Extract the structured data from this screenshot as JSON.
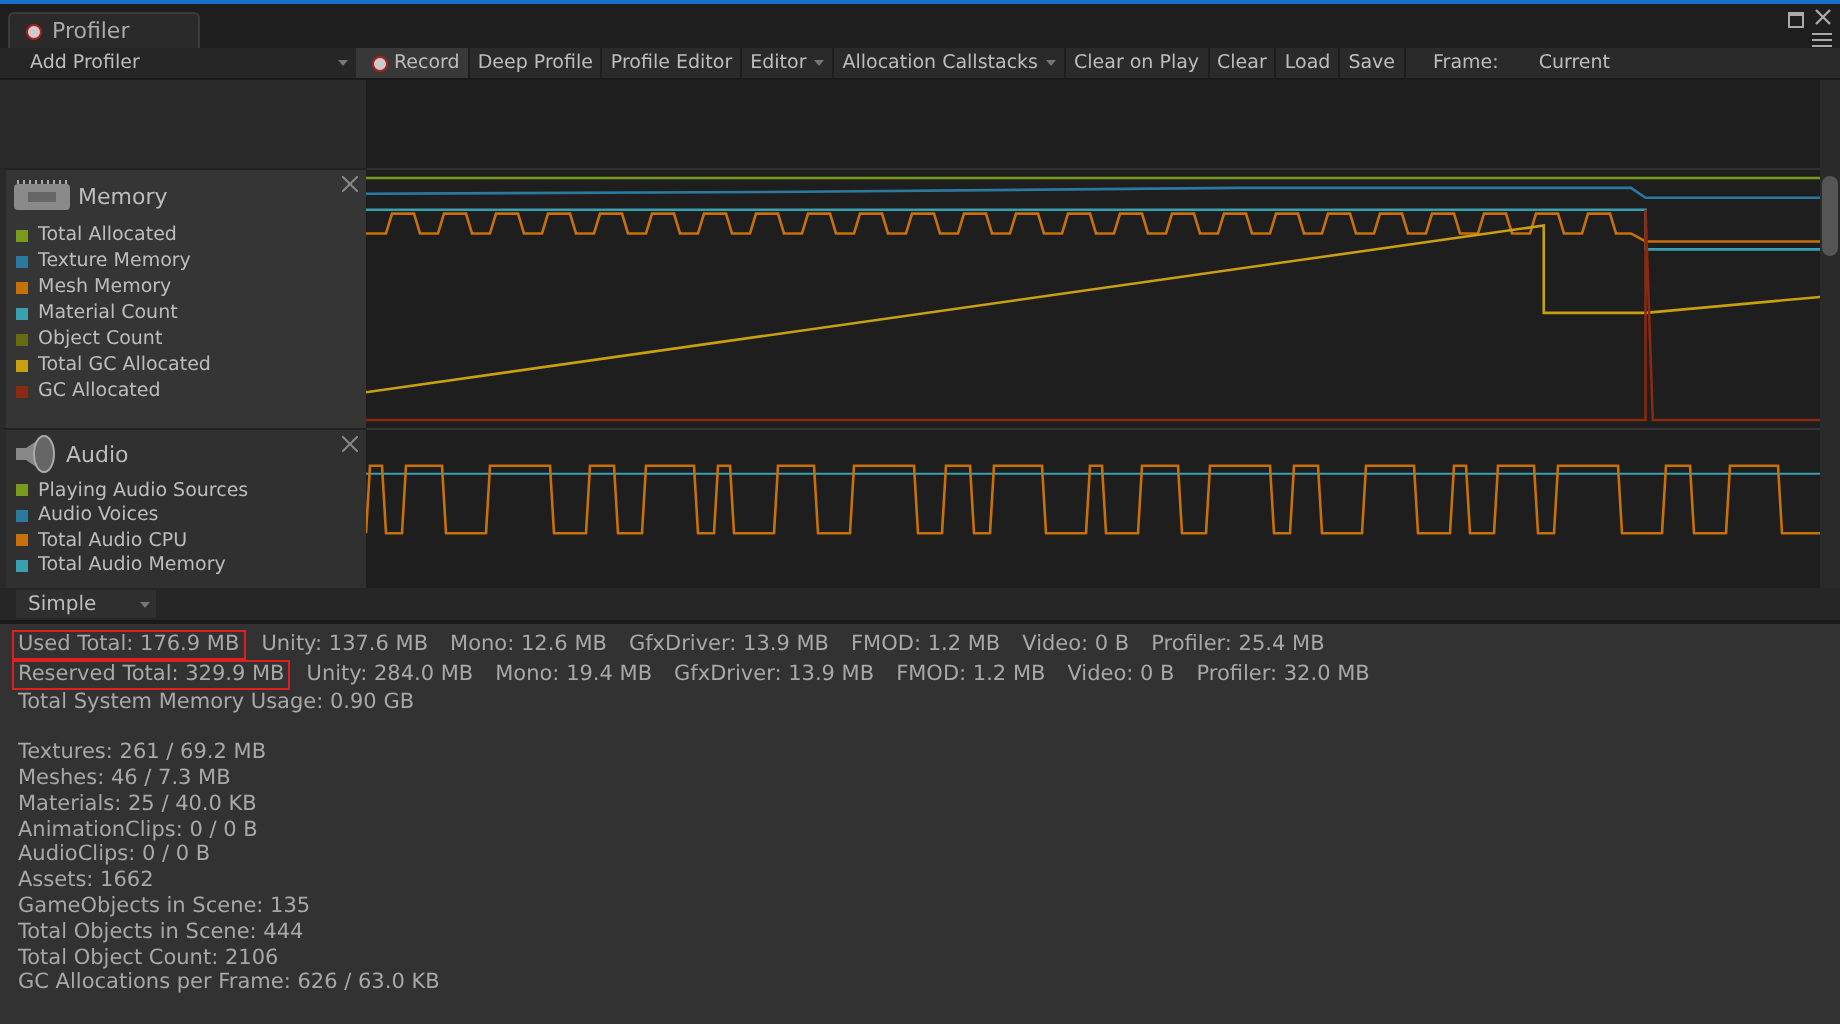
{
  "window": {
    "tab_title": "Profiler"
  },
  "toolbar": {
    "add_profiler": "Add Profiler",
    "items": [
      {
        "label": "Record",
        "kind": "record"
      },
      {
        "label": "Deep Profile",
        "kind": "button"
      },
      {
        "label": "Profile Editor",
        "kind": "button"
      },
      {
        "label": "Editor",
        "kind": "dropdown"
      },
      {
        "label": "Allocation Callstacks",
        "kind": "dropdown"
      },
      {
        "label": "Clear on Play",
        "kind": "button"
      },
      {
        "label": "Clear",
        "kind": "button"
      },
      {
        "label": "Load",
        "kind": "button"
      },
      {
        "label": "Save",
        "kind": "button"
      }
    ],
    "frame_label": "Frame:",
    "frame_value": "Current"
  },
  "modules": [
    {
      "name": "Memory",
      "kind": "memory",
      "legend": [
        {
          "label": "Total Allocated",
          "color": "#7a9a1e"
        },
        {
          "label": "Texture Memory",
          "color": "#2a7aa0"
        },
        {
          "label": "Mesh Memory",
          "color": "#c8700a"
        },
        {
          "label": "Material Count",
          "color": "#3aa0b0"
        },
        {
          "label": "Object Count",
          "color": "#6a6a10"
        },
        {
          "label": "Total GC Allocated",
          "color": "#c8a010"
        },
        {
          "label": "GC Allocated",
          "color": "#8a2a10"
        }
      ]
    },
    {
      "name": "Audio",
      "kind": "audio",
      "legend": [
        {
          "label": "Playing Audio Sources",
          "color": "#7a9a1e"
        },
        {
          "label": "Audio Voices",
          "color": "#2a7aa0"
        },
        {
          "label": "Total Audio CPU",
          "color": "#c8700a"
        },
        {
          "label": "Total Audio Memory",
          "color": "#3aa0b0"
        }
      ]
    }
  ],
  "view_mode": "Simple",
  "details": {
    "memory_rows": [
      {
        "items": [
          {
            "text": "Used Total: 176.9 MB",
            "highlighted": true
          },
          {
            "text": "Unity: 137.6 MB",
            "highlighted": false
          },
          {
            "text": "Mono: 12.6 MB",
            "highlighted": false
          },
          {
            "text": "GfxDriver: 13.9 MB",
            "highlighted": false
          },
          {
            "text": "FMOD: 1.2 MB",
            "highlighted": false
          },
          {
            "text": "Video: 0 B",
            "highlighted": false
          },
          {
            "text": "Profiler: 25.4 MB",
            "highlighted": false
          }
        ]
      },
      {
        "items": [
          {
            "text": "Reserved Total: 329.9 MB",
            "highlighted": true
          },
          {
            "text": "Unity: 284.0 MB",
            "highlighted": false
          },
          {
            "text": "Mono: 19.4 MB",
            "highlighted": false
          },
          {
            "text": "GfxDriver: 13.9 MB",
            "highlighted": false
          },
          {
            "text": "FMOD: 1.2 MB",
            "highlighted": false
          },
          {
            "text": "Video: 0 B",
            "highlighted": false
          },
          {
            "text": "Profiler: 32.0 MB",
            "highlighted": false
          }
        ]
      }
    ],
    "system_usage": "Total System Memory Usage: 0.90 GB",
    "stats": [
      "Textures: 261 / 69.2 MB",
      "Meshes: 46 / 7.3 MB",
      "Materials: 25 / 40.0 KB",
      "AnimationClips: 0 / 0 B",
      "AudioClips: 0 / 0 B",
      "Assets: 1662",
      "GameObjects in Scene: 135",
      "Total Objects in Scene: 444",
      "Total Object Count: 2106",
      "GC Allocations per Frame: 626 / 63.0 KB"
    ]
  }
}
